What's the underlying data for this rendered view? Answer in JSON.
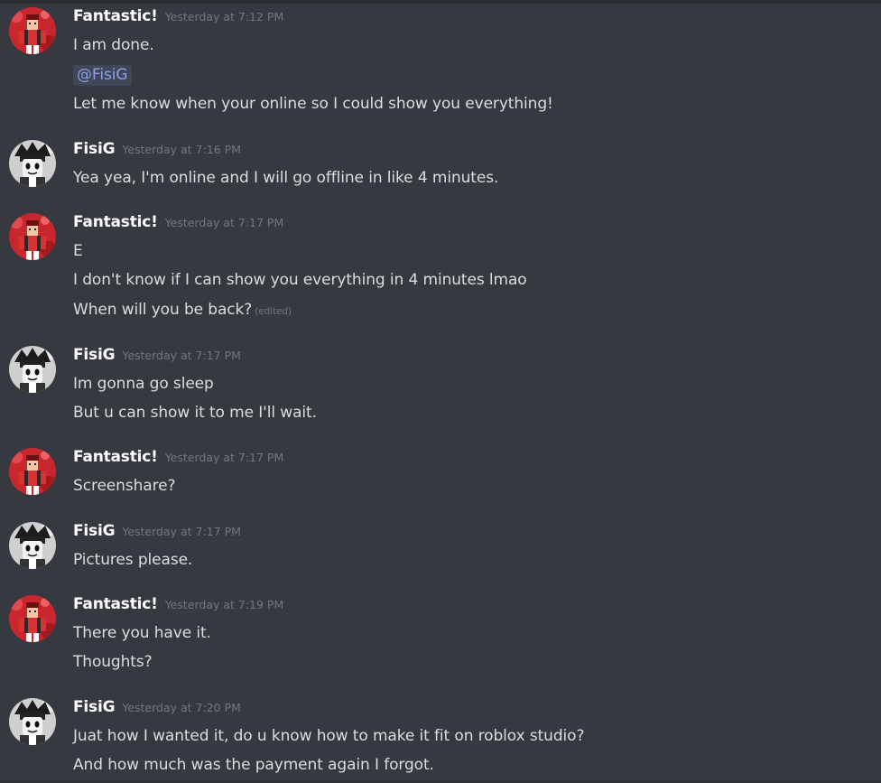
{
  "colors": {
    "background": "#36393f",
    "author": "#ffffff",
    "text": "#dcddde",
    "timestamp": "#72767d",
    "mention": "#8ea1e1"
  },
  "users": {
    "fantastic": {
      "name": "Fantastic!",
      "avatar_icon": "red-avatar-icon"
    },
    "fisig": {
      "name": "FisiG",
      "avatar_icon": "grey-avatar-icon"
    }
  },
  "messages": [
    {
      "author": "Fantastic!",
      "timestamp": "Yesterday at 7:12 PM",
      "lines": [
        {
          "text": "I am done."
        },
        {
          "mention": "@FisiG"
        },
        {
          "text": "Let me know when your online so I could show you everything!"
        }
      ]
    },
    {
      "author": "FisiG",
      "timestamp": "Yesterday at 7:16 PM",
      "lines": [
        {
          "text": "Yea yea, I'm online and I will go offline in like 4 minutes."
        }
      ]
    },
    {
      "author": "Fantastic!",
      "timestamp": "Yesterday at 7:17 PM",
      "lines": [
        {
          "text": "E"
        },
        {
          "text": "I don't know if I can show you everything in 4 minutes lmao"
        },
        {
          "text": "When will you be back?",
          "edited": "(edited)"
        }
      ]
    },
    {
      "author": "FisiG",
      "timestamp": "Yesterday at 7:17 PM",
      "lines": [
        {
          "text": "Im gonna go sleep"
        },
        {
          "text": "But u can show it to me I'll wait."
        }
      ]
    },
    {
      "author": "Fantastic!",
      "timestamp": "Yesterday at 7:17 PM",
      "lines": [
        {
          "text": "Screenshare?"
        }
      ]
    },
    {
      "author": "FisiG",
      "timestamp": "Yesterday at 7:17 PM",
      "lines": [
        {
          "text": "Pictures please."
        }
      ]
    },
    {
      "author": "Fantastic!",
      "timestamp": "Yesterday at 7:19 PM",
      "lines": [
        {
          "text": "There you have it."
        },
        {
          "text": "Thoughts?"
        }
      ]
    },
    {
      "author": "FisiG",
      "timestamp": "Yesterday at 7:20 PM",
      "lines": [
        {
          "text": "Juat how I wanted it, do u know how to make it fit on roblox studio?"
        },
        {
          "text": "And how much was the payment again I forgot."
        }
      ]
    }
  ]
}
